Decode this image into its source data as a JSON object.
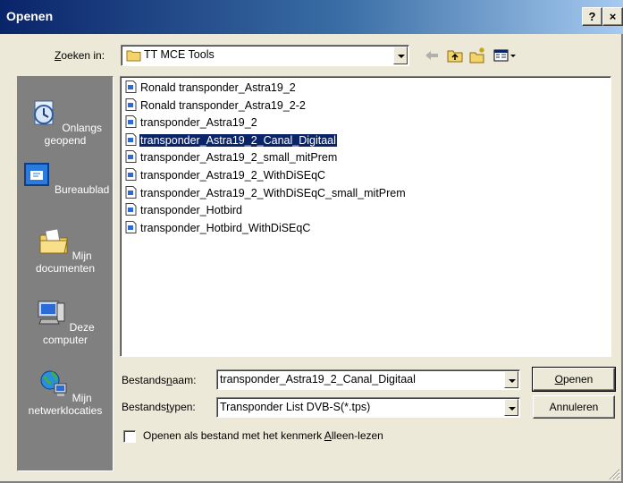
{
  "window": {
    "title": "Openen",
    "help_label": "?",
    "close_label": "×"
  },
  "lookin": {
    "label_prefix": "",
    "label_mnemonic": "Z",
    "label_rest": "oeken in:",
    "value": "TT MCE Tools"
  },
  "toolbar": {
    "icons": [
      "back-arrow-icon",
      "up-folder-icon",
      "new-folder-icon",
      "view-menu-icon"
    ]
  },
  "places": [
    {
      "label": "Onlangs geopend",
      "icon": "recent-documents-icon"
    },
    {
      "label": "Bureaublad",
      "icon": "desktop-icon"
    },
    {
      "label": "Mijn documenten",
      "icon": "my-documents-icon"
    },
    {
      "label": "Deze computer",
      "icon": "my-computer-icon"
    },
    {
      "label": "Mijn netwerklocaties",
      "icon": "network-places-icon"
    }
  ],
  "files": [
    "Ronald transponder_Astra19_2",
    "Ronald transponder_Astra19_2-2",
    "transponder_Astra19_2",
    "transponder_Astra19_2_Canal_Digitaal",
    "transponder_Astra19_2_small_mitPrem",
    "transponder_Astra19_2_WithDiSEqC",
    "transponder_Astra19_2_WithDiSEqC_small_mitPrem",
    "transponder_Hotbird",
    "transponder_Hotbird_WithDiSEqC"
  ],
  "selected_file_index": 3,
  "filename": {
    "label_prefix": "Bestands",
    "label_mnemonic": "n",
    "label_rest": "aam:",
    "value": "transponder_Astra19_2_Canal_Digitaal"
  },
  "filetype": {
    "label_prefix": "Bestands",
    "label_mnemonic": "t",
    "label_rest": "ypen:",
    "value": "Transponder List DVB-S(*.tps)"
  },
  "buttons": {
    "open_mnemonic": "O",
    "open_rest": "penen",
    "cancel": "Annuleren"
  },
  "readonly": {
    "label_prefix": "Openen als bestand met het kenmerk ",
    "label_mnemonic": "A",
    "label_rest": "lleen-lezen",
    "checked": false
  },
  "colors": {
    "title_bar": "#0a246a",
    "selection": "#0a246a",
    "dialog_bg": "#ece9d8",
    "places_bar": "#808080"
  }
}
